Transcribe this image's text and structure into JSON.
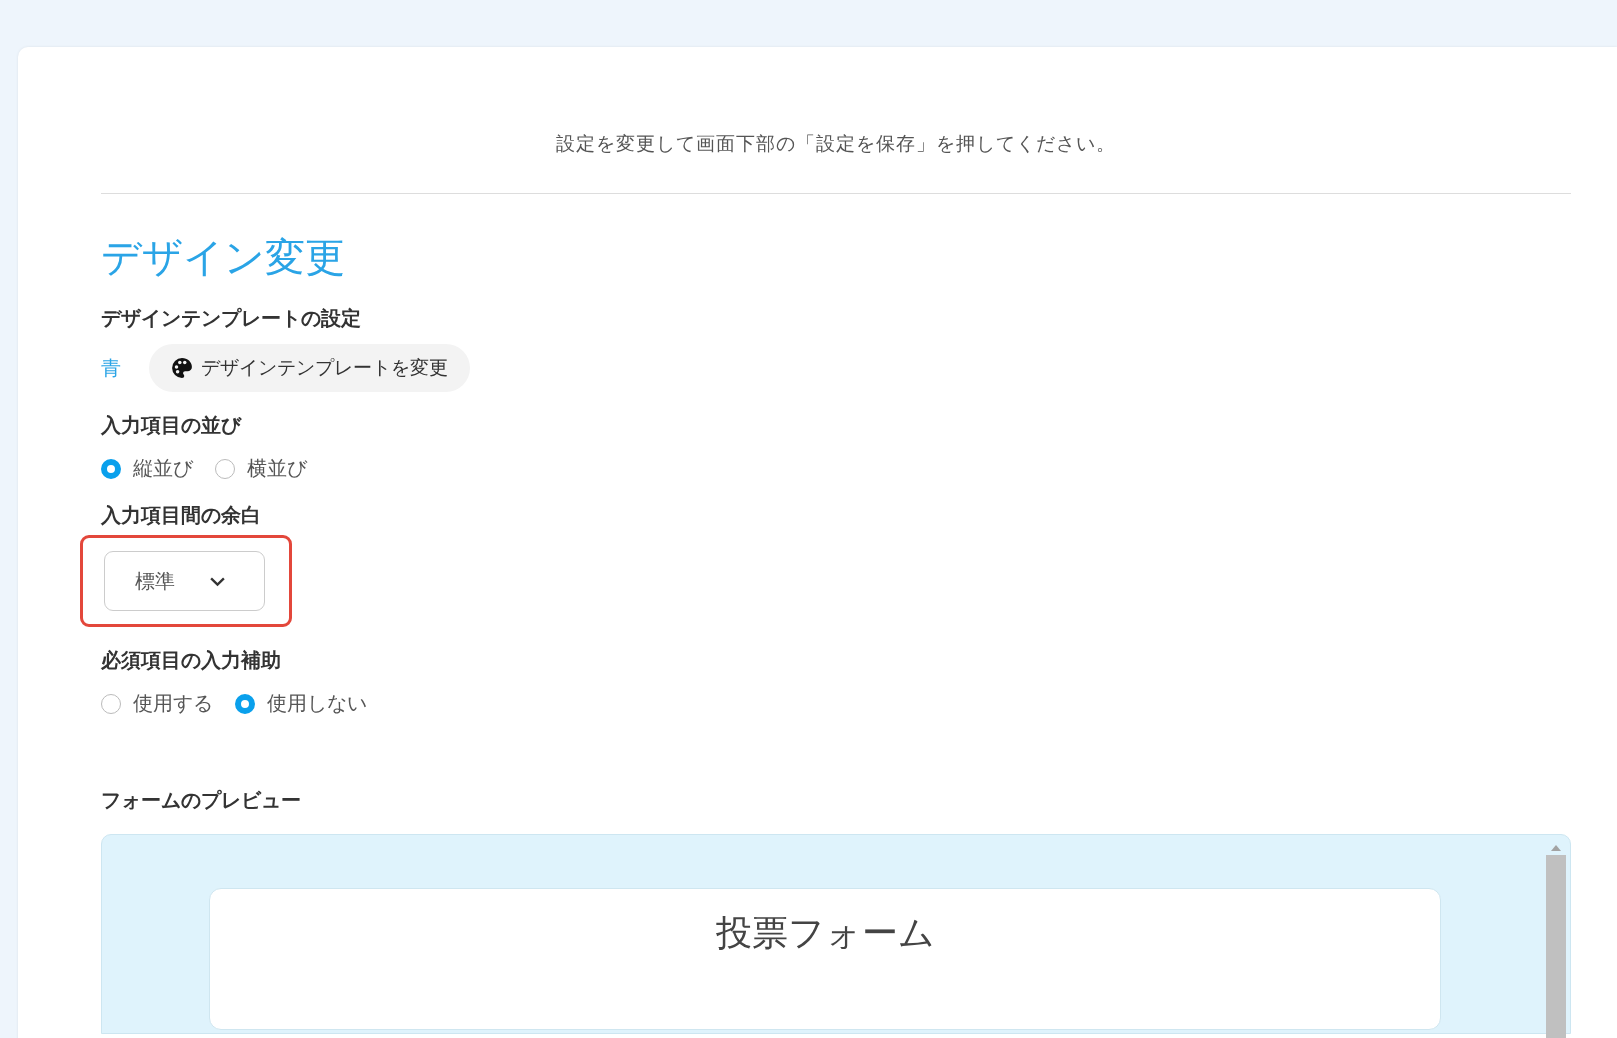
{
  "instruction": "設定を変更して画面下部の「設定を保存」を押してください。",
  "section_title": "デザイン変更",
  "template": {
    "label": "デザインテンプレートの設定",
    "current": "青",
    "button": "デザインテンプレートを変更"
  },
  "layout": {
    "label": "入力項目の並び",
    "options": [
      {
        "label": "縦並び",
        "selected": true
      },
      {
        "label": "横並び",
        "selected": false
      }
    ]
  },
  "spacing": {
    "label": "入力項目間の余白",
    "value": "標準",
    "highlighted": true
  },
  "required_assist": {
    "label": "必須項目の入力補助",
    "options": [
      {
        "label": "使用する",
        "selected": false
      },
      {
        "label": "使用しない",
        "selected": true
      }
    ]
  },
  "preview": {
    "label": "フォームのプレビュー",
    "form_title": "投票フォーム"
  }
}
